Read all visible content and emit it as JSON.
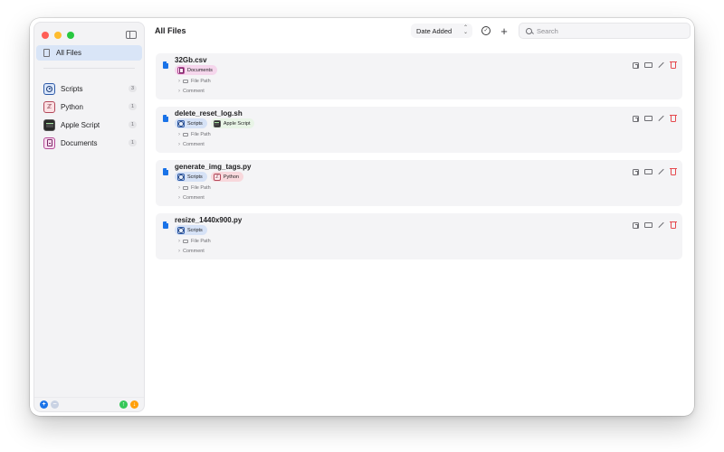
{
  "toolbar": {
    "title": "All Files",
    "sort_label": "Date Added",
    "sort_chevron": "⌃⌄",
    "check_glyph": "✓",
    "add_glyph": "+",
    "search_placeholder": "Search"
  },
  "sidebar": {
    "all_files_label": "All Files",
    "categories": [
      {
        "label": "Scripts",
        "count": "3",
        "icon": "scripts-icon"
      },
      {
        "label": "Python",
        "count": "1",
        "icon": "python-icon"
      },
      {
        "label": "Apple Script",
        "count": "1",
        "icon": "apple-script-icon"
      },
      {
        "label": "Documents",
        "count": "1",
        "icon": "documents-icon"
      }
    ],
    "footer": {
      "add_glyph": "+",
      "remove_glyph": "−",
      "upload_glyph": "↑",
      "download_glyph": "↓"
    }
  },
  "python_glyph": "ℤ",
  "files": [
    {
      "name": "32Gb.csv",
      "tags": [
        "Documents"
      ],
      "file_path_label": "File Path",
      "comment_label": "Comment"
    },
    {
      "name": "delete_reset_log.sh",
      "tags": [
        "Scripts",
        "Apple Script"
      ],
      "file_path_label": "File Path",
      "comment_label": "Comment"
    },
    {
      "name": "generate_img_tags.py",
      "tags": [
        "Scripts",
        "Python"
      ],
      "file_path_label": "File Path",
      "comment_label": "Comment"
    },
    {
      "name": "resize_1440x900.py",
      "tags": [
        "Scripts"
      ],
      "file_path_label": "File Path",
      "comment_label": "Comment"
    }
  ],
  "chevron_glyph": "›",
  "colors": {
    "accent": "#1a73e8",
    "selection": "#d9e5f7",
    "delete": "#e5484d"
  }
}
